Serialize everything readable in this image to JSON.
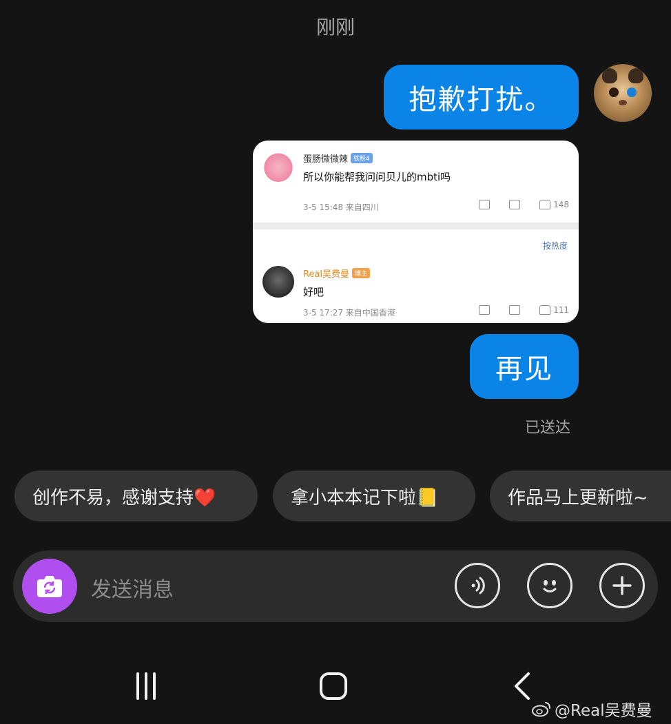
{
  "header": {
    "timestamp": "刚刚"
  },
  "messages": {
    "msg1": "抱歉打扰。",
    "msg2": "再见",
    "status": "已送达"
  },
  "shared_card": {
    "comment1": {
      "username": "蛋肠微微辣",
      "badge": "铁粉4",
      "text": "所以你能帮我问问贝儿的mbti吗",
      "meta": "3-5 15:48 来自四川",
      "likes": "148"
    },
    "sort_label": "按热度",
    "comment2": {
      "username": "Real吴费曼",
      "badge": "博主",
      "text": "好吧",
      "meta": "3-5 17:27 来自中国香港",
      "likes": "111"
    }
  },
  "quick_replies": [
    "创作不易，感谢支持❤️",
    "拿小本本记下啦📒",
    "作品马上更新啦~"
  ],
  "input": {
    "placeholder": "发送消息"
  },
  "watermark": "@Real吴费曼",
  "colors": {
    "background": "#141414",
    "bubble": "#0a84e6",
    "camera_button": "#b04ef0",
    "chip": "#333333"
  }
}
